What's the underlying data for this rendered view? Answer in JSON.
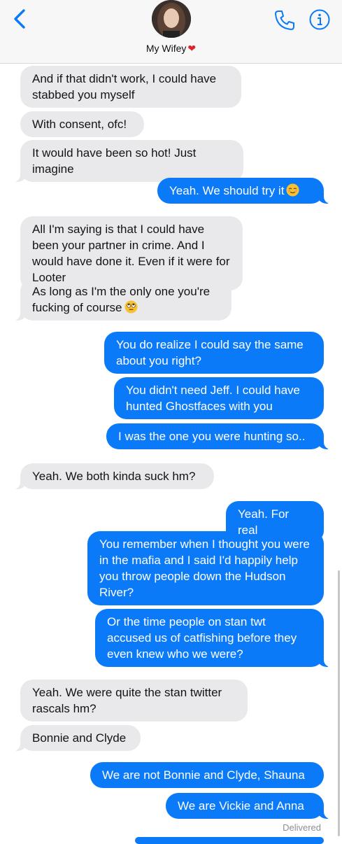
{
  "header": {
    "contact_name": "My Wifey",
    "back_icon": "chevron-left-icon",
    "call_icon": "phone-icon",
    "info_icon": "info-icon",
    "accent": "#0a7af9"
  },
  "messages": [
    {
      "dir": "in",
      "text": "And if that didn't work, I could have stabbed you myself"
    },
    {
      "dir": "in",
      "text": "With consent, ofc!"
    },
    {
      "dir": "in",
      "text": "It would have been so hot! Just imagine"
    },
    {
      "dir": "out",
      "text": "Yeah. We should try it",
      "emoji": "relieved-face"
    },
    {
      "dir": "in",
      "text": "All I'm saying is that I could have been your partner in crime. And I would have done it. Even if it were for Looter"
    },
    {
      "dir": "in",
      "text": "As long as I'm the only one you're fucking of course",
      "emoji": "eye-roll-face"
    },
    {
      "dir": "out",
      "text": "You do realize I could say the same about you right?"
    },
    {
      "dir": "out",
      "text": "You didn't need Jeff. I could have hunted Ghostfaces with you"
    },
    {
      "dir": "out",
      "text": "I was the one you were hunting so.."
    },
    {
      "dir": "in",
      "text": "Yeah. We both kinda suck hm?"
    },
    {
      "dir": "out",
      "text": "Yeah. For real"
    },
    {
      "dir": "out",
      "text": "You remember when I thought you were in the mafia and I said I'd happily help you throw people down the Hudson River?"
    },
    {
      "dir": "out",
      "text": "Or the time people on stan twt accused us of catfishing before they even knew who we were?"
    },
    {
      "dir": "in",
      "text": "Yeah. We were quite the stan twitter rascals hm?"
    },
    {
      "dir": "in",
      "text": "Bonnie and Clyde"
    },
    {
      "dir": "out",
      "text": "We are not Bonnie and Clyde, Shauna"
    },
    {
      "dir": "out",
      "text": "We are Vickie and Anna"
    }
  ],
  "status": {
    "delivered": "Delivered"
  }
}
